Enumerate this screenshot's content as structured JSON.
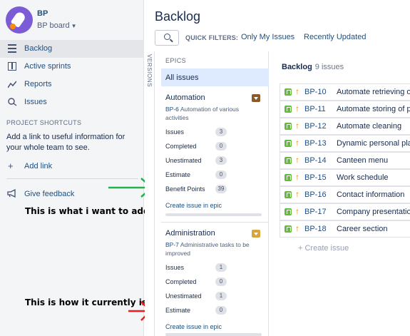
{
  "sidebar": {
    "project_name": "BP",
    "board_name": "BP board",
    "nav": [
      {
        "label": "Backlog"
      },
      {
        "label": "Active sprints"
      },
      {
        "label": "Reports"
      },
      {
        "label": "Issues"
      }
    ],
    "shortcuts_title": "PROJECT SHORTCUTS",
    "shortcuts_text": "Add a link to useful information for your whole team to see.",
    "add_link": "Add link",
    "feedback": "Give feedback"
  },
  "annotations": {
    "want": "This is what i want to add",
    "current": "This is how it currently is.",
    "arrow_colors": {
      "want": "#22b14c",
      "current": "#ed1c24"
    }
  },
  "header": {
    "title": "Backlog",
    "quick_filters_label": "QUICK FILTERS:",
    "filters": [
      "Only My Issues",
      "Recently Updated"
    ]
  },
  "versions_tab": "VERSIONS",
  "epics_panel": {
    "title": "EPICS",
    "all_issues": "All issues",
    "epics": [
      {
        "name": "Automation",
        "color": "#8a5a2b",
        "key": "BP-6",
        "description": "Automation of various activities",
        "stats": [
          {
            "label": "Issues",
            "value": "3"
          },
          {
            "label": "Completed",
            "value": "0"
          },
          {
            "label": "Unestimated",
            "value": "3"
          },
          {
            "label": "Estimate",
            "value": "0"
          },
          {
            "label": "Benefit Points",
            "value": "39"
          }
        ],
        "create": "Create issue in epic"
      },
      {
        "name": "Administration",
        "color": "#d9a53a",
        "key": "BP-7",
        "description": "Administrative tasks to be improved",
        "stats": [
          {
            "label": "Issues",
            "value": "1"
          },
          {
            "label": "Completed",
            "value": "0"
          },
          {
            "label": "Unestimated",
            "value": "1"
          },
          {
            "label": "Estimate",
            "value": "0"
          }
        ],
        "create": "Create issue in epic"
      }
    ]
  },
  "backlog": {
    "title": "Backlog",
    "count": "9 issues",
    "issues": [
      {
        "key": "BP-10",
        "summary": "Automate retrieving of pa"
      },
      {
        "key": "BP-11",
        "summary": "Automate storing of parc"
      },
      {
        "key": "BP-12",
        "summary": "Automate cleaning"
      },
      {
        "key": "BP-13",
        "summary": "Dynamic personal planni"
      },
      {
        "key": "BP-14",
        "summary": "Canteen menu"
      },
      {
        "key": "BP-15",
        "summary": "Work schedule"
      },
      {
        "key": "BP-16",
        "summary": "Contact information"
      },
      {
        "key": "BP-17",
        "summary": "Company presentation"
      },
      {
        "key": "BP-18",
        "summary": "Career section"
      }
    ],
    "create_issue": "+ Create issue"
  }
}
